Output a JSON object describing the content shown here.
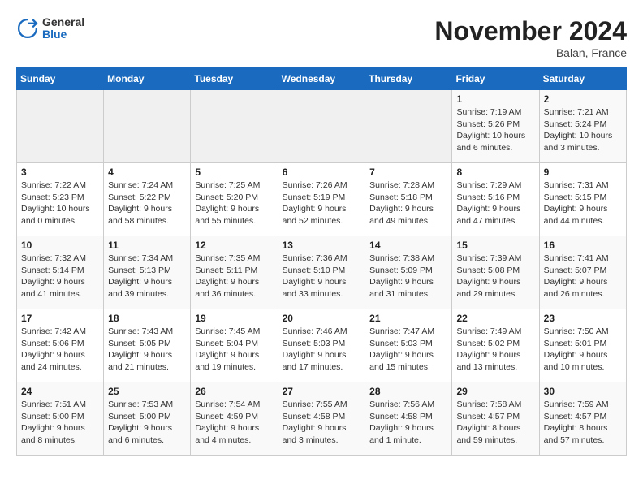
{
  "logo": {
    "general": "General",
    "blue": "Blue"
  },
  "header": {
    "title": "November 2024",
    "subtitle": "Balan, France"
  },
  "weekdays": [
    "Sunday",
    "Monday",
    "Tuesday",
    "Wednesday",
    "Thursday",
    "Friday",
    "Saturday"
  ],
  "weeks": [
    [
      {
        "day": "",
        "info": ""
      },
      {
        "day": "",
        "info": ""
      },
      {
        "day": "",
        "info": ""
      },
      {
        "day": "",
        "info": ""
      },
      {
        "day": "",
        "info": ""
      },
      {
        "day": "1",
        "info": "Sunrise: 7:19 AM\nSunset: 5:26 PM\nDaylight: 10 hours\nand 6 minutes."
      },
      {
        "day": "2",
        "info": "Sunrise: 7:21 AM\nSunset: 5:24 PM\nDaylight: 10 hours\nand 3 minutes."
      }
    ],
    [
      {
        "day": "3",
        "info": "Sunrise: 7:22 AM\nSunset: 5:23 PM\nDaylight: 10 hours\nand 0 minutes."
      },
      {
        "day": "4",
        "info": "Sunrise: 7:24 AM\nSunset: 5:22 PM\nDaylight: 9 hours\nand 58 minutes."
      },
      {
        "day": "5",
        "info": "Sunrise: 7:25 AM\nSunset: 5:20 PM\nDaylight: 9 hours\nand 55 minutes."
      },
      {
        "day": "6",
        "info": "Sunrise: 7:26 AM\nSunset: 5:19 PM\nDaylight: 9 hours\nand 52 minutes."
      },
      {
        "day": "7",
        "info": "Sunrise: 7:28 AM\nSunset: 5:18 PM\nDaylight: 9 hours\nand 49 minutes."
      },
      {
        "day": "8",
        "info": "Sunrise: 7:29 AM\nSunset: 5:16 PM\nDaylight: 9 hours\nand 47 minutes."
      },
      {
        "day": "9",
        "info": "Sunrise: 7:31 AM\nSunset: 5:15 PM\nDaylight: 9 hours\nand 44 minutes."
      }
    ],
    [
      {
        "day": "10",
        "info": "Sunrise: 7:32 AM\nSunset: 5:14 PM\nDaylight: 9 hours\nand 41 minutes."
      },
      {
        "day": "11",
        "info": "Sunrise: 7:34 AM\nSunset: 5:13 PM\nDaylight: 9 hours\nand 39 minutes."
      },
      {
        "day": "12",
        "info": "Sunrise: 7:35 AM\nSunset: 5:11 PM\nDaylight: 9 hours\nand 36 minutes."
      },
      {
        "day": "13",
        "info": "Sunrise: 7:36 AM\nSunset: 5:10 PM\nDaylight: 9 hours\nand 33 minutes."
      },
      {
        "day": "14",
        "info": "Sunrise: 7:38 AM\nSunset: 5:09 PM\nDaylight: 9 hours\nand 31 minutes."
      },
      {
        "day": "15",
        "info": "Sunrise: 7:39 AM\nSunset: 5:08 PM\nDaylight: 9 hours\nand 29 minutes."
      },
      {
        "day": "16",
        "info": "Sunrise: 7:41 AM\nSunset: 5:07 PM\nDaylight: 9 hours\nand 26 minutes."
      }
    ],
    [
      {
        "day": "17",
        "info": "Sunrise: 7:42 AM\nSunset: 5:06 PM\nDaylight: 9 hours\nand 24 minutes."
      },
      {
        "day": "18",
        "info": "Sunrise: 7:43 AM\nSunset: 5:05 PM\nDaylight: 9 hours\nand 21 minutes."
      },
      {
        "day": "19",
        "info": "Sunrise: 7:45 AM\nSunset: 5:04 PM\nDaylight: 9 hours\nand 19 minutes."
      },
      {
        "day": "20",
        "info": "Sunrise: 7:46 AM\nSunset: 5:03 PM\nDaylight: 9 hours\nand 17 minutes."
      },
      {
        "day": "21",
        "info": "Sunrise: 7:47 AM\nSunset: 5:03 PM\nDaylight: 9 hours\nand 15 minutes."
      },
      {
        "day": "22",
        "info": "Sunrise: 7:49 AM\nSunset: 5:02 PM\nDaylight: 9 hours\nand 13 minutes."
      },
      {
        "day": "23",
        "info": "Sunrise: 7:50 AM\nSunset: 5:01 PM\nDaylight: 9 hours\nand 10 minutes."
      }
    ],
    [
      {
        "day": "24",
        "info": "Sunrise: 7:51 AM\nSunset: 5:00 PM\nDaylight: 9 hours\nand 8 minutes."
      },
      {
        "day": "25",
        "info": "Sunrise: 7:53 AM\nSunset: 5:00 PM\nDaylight: 9 hours\nand 6 minutes."
      },
      {
        "day": "26",
        "info": "Sunrise: 7:54 AM\nSunset: 4:59 PM\nDaylight: 9 hours\nand 4 minutes."
      },
      {
        "day": "27",
        "info": "Sunrise: 7:55 AM\nSunset: 4:58 PM\nDaylight: 9 hours\nand 3 minutes."
      },
      {
        "day": "28",
        "info": "Sunrise: 7:56 AM\nSunset: 4:58 PM\nDaylight: 9 hours\nand 1 minute."
      },
      {
        "day": "29",
        "info": "Sunrise: 7:58 AM\nSunset: 4:57 PM\nDaylight: 8 hours\nand 59 minutes."
      },
      {
        "day": "30",
        "info": "Sunrise: 7:59 AM\nSunset: 4:57 PM\nDaylight: 8 hours\nand 57 minutes."
      }
    ]
  ]
}
